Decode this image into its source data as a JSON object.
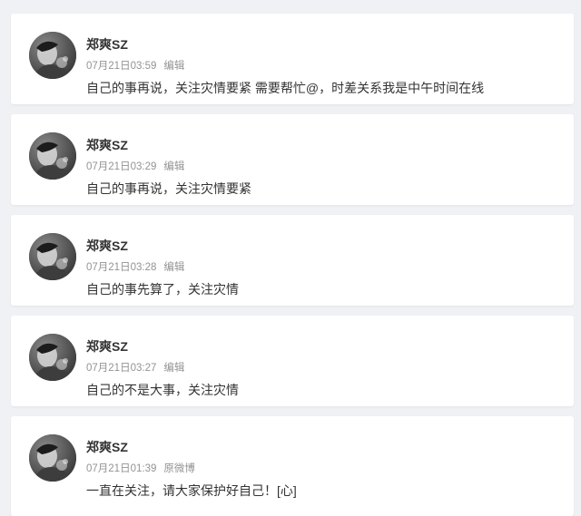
{
  "posts": [
    {
      "author": "郑爽SZ",
      "time": "07月21日03:59",
      "action": "编辑",
      "text": "自己的事再说，关注灾情要紧 需要帮忙@，时差关系我是中午时间在线",
      "avatar_icon": "profile-photo-icon"
    },
    {
      "author": "郑爽SZ",
      "time": "07月21日03:29",
      "action": "编辑",
      "text": "自己的事再说，关注灾情要紧",
      "avatar_icon": "profile-photo-icon"
    },
    {
      "author": "郑爽SZ",
      "time": "07月21日03:28",
      "action": "编辑",
      "text": "自己的事先算了，关注灾情",
      "avatar_icon": "profile-photo-icon"
    },
    {
      "author": "郑爽SZ",
      "time": "07月21日03:27",
      "action": "编辑",
      "text": "自己的不是大事，关注灾情",
      "avatar_icon": "profile-photo-icon"
    },
    {
      "author": "郑爽SZ",
      "time": "07月21日01:39",
      "action": "原微博",
      "text": "一直在关注，请大家保护好自己！[心]",
      "avatar_icon": "profile-photo-icon"
    }
  ],
  "colors": {
    "page_background": "#f0f1f4",
    "card_background": "#ffffff",
    "author_text": "#333333",
    "meta_text": "#939393",
    "body_text": "#333333"
  }
}
